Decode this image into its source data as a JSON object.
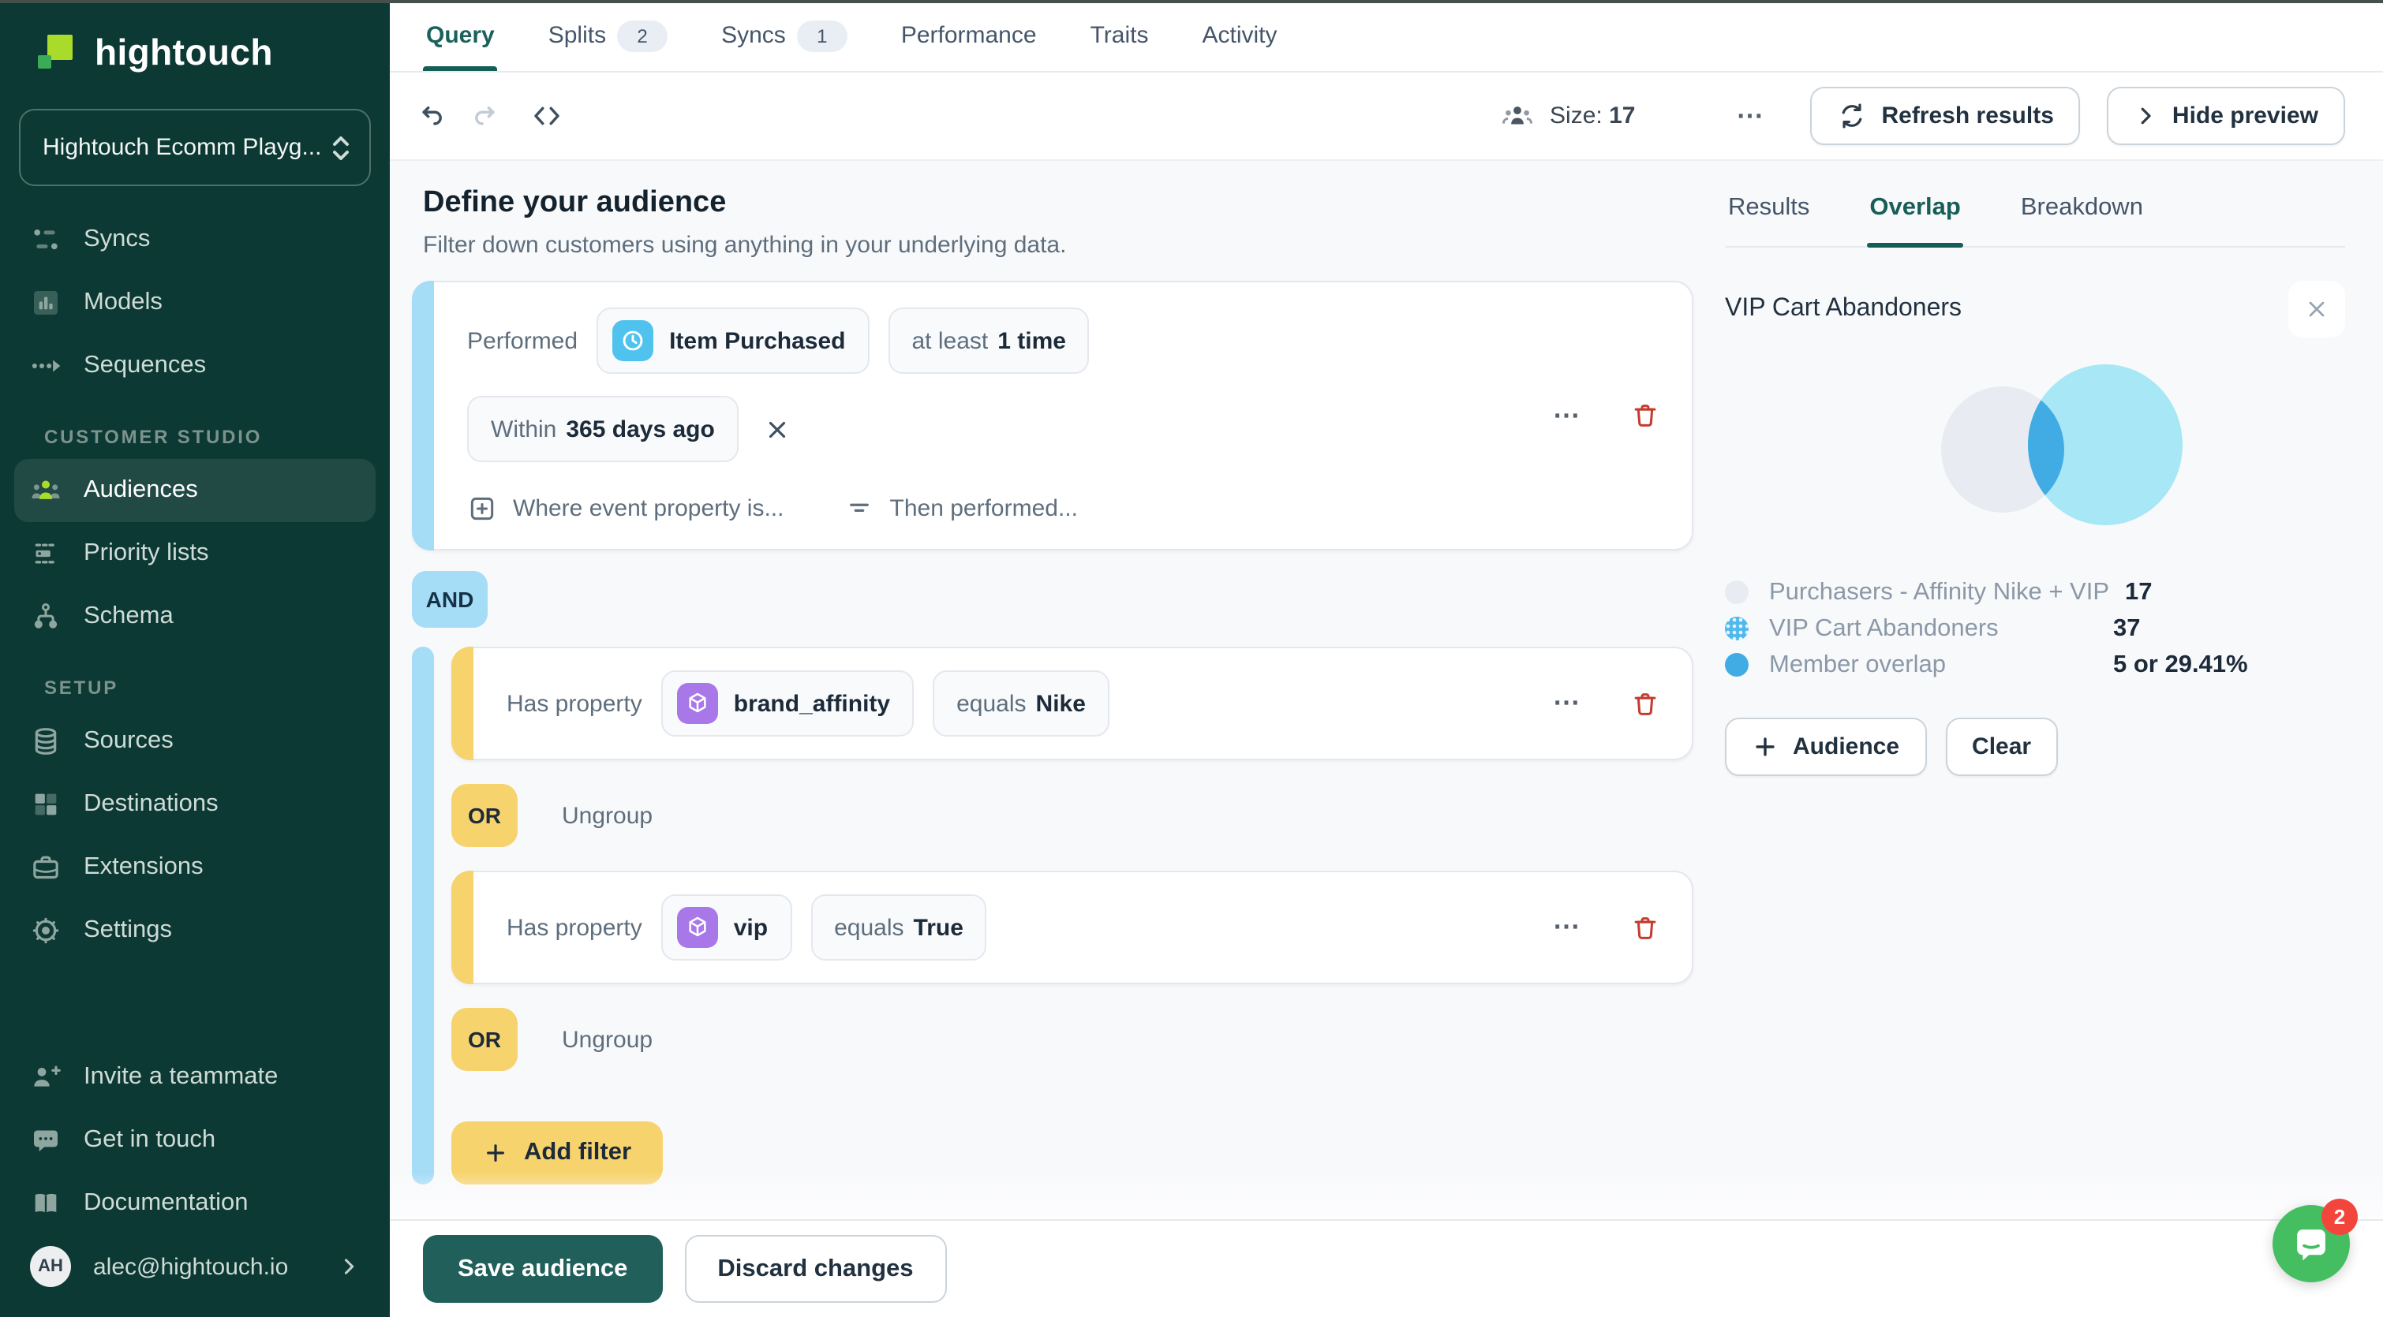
{
  "ui": {
    "more": "⋯"
  },
  "sidebar": {
    "logo": "hightouch",
    "workspace": "Hightouch Ecomm Playg...",
    "nav": [
      {
        "label": "Syncs"
      },
      {
        "label": "Models"
      },
      {
        "label": "Sequences"
      }
    ],
    "customer_studio": {
      "label": "CUSTOMER STUDIO",
      "items": [
        {
          "label": "Audiences",
          "active": true
        },
        {
          "label": "Priority lists"
        },
        {
          "label": "Schema"
        }
      ]
    },
    "setup": {
      "label": "SETUP",
      "items": [
        {
          "label": "Sources"
        },
        {
          "label": "Destinations"
        },
        {
          "label": "Extensions"
        },
        {
          "label": "Settings"
        }
      ]
    },
    "footer": [
      {
        "label": "Invite a teammate"
      },
      {
        "label": "Get in touch"
      },
      {
        "label": "Documentation"
      }
    ],
    "account": {
      "initials": "AH",
      "email": "alec@hightouch.io"
    }
  },
  "header": {
    "tabs": [
      {
        "label": "Query",
        "active": true
      },
      {
        "label": "Splits",
        "badge": "2"
      },
      {
        "label": "Syncs",
        "badge": "1"
      },
      {
        "label": "Performance"
      },
      {
        "label": "Traits"
      },
      {
        "label": "Activity"
      }
    ]
  },
  "toolbar": {
    "size_label": "Size:",
    "size_value": "17",
    "refresh": "Refresh results",
    "hide_preview": "Hide preview"
  },
  "builder": {
    "title": "Define your audience",
    "subtitle": "Filter down customers using anything in your underlying data.",
    "performed": {
      "prefix": "Performed",
      "event": "Item Purchased",
      "condition_label": "at least",
      "condition_value": "1 time",
      "window_label": "Within",
      "window_value": "365 days ago",
      "action_event_property": "Where event property is...",
      "action_then_performed": "Then performed..."
    },
    "and": "AND",
    "or": "OR",
    "ungroup": "Ungroup",
    "filters": [
      {
        "prefix": "Has property",
        "property": "brand_affinity",
        "operator": "equals",
        "value": "Nike"
      },
      {
        "prefix": "Has property",
        "property": "vip",
        "operator": "equals",
        "value": "True"
      }
    ],
    "add_filter": "Add filter",
    "save": "Save audience",
    "discard": "Discard changes"
  },
  "preview": {
    "tabs": [
      {
        "label": "Results"
      },
      {
        "label": "Overlap",
        "active": true
      },
      {
        "label": "Breakdown"
      }
    ],
    "selected_audience": "VIP Cart Abandoners",
    "legend": [
      {
        "label": "Purchasers - Affinity Nike + VIP",
        "value": "17"
      },
      {
        "label": "VIP Cart Abandoners",
        "value": "37"
      },
      {
        "label": "Member overlap",
        "value": "5 or 29.41%"
      }
    ],
    "add_audience": "Audience",
    "clear": "Clear"
  },
  "chart_data": {
    "type": "venn",
    "sets": [
      {
        "label": "Purchasers - Affinity Nike + VIP",
        "size": 17,
        "color": "#E9EBF3"
      },
      {
        "label": "VIP Cart Abandoners",
        "size": 37,
        "color": "#A7E7F6"
      }
    ],
    "intersection": {
      "label": "Member overlap",
      "size": 5,
      "percent": 29.41,
      "color": "#41ACE3"
    },
    "legend_position": "bottom"
  },
  "intercom": {
    "badge": "2"
  },
  "colors": {
    "sidebar_bg": "#0C3933",
    "accent_teal": "#1F615C",
    "accent_blue": "#A5DCF6",
    "accent_yellow": "#F7D36E",
    "event_icon_blue": "#4FC3EE",
    "property_icon_purple": "#A878E9",
    "danger_red": "#C43C2E",
    "venn_left": "#E9EBF3",
    "venn_right": "#A7E7F6",
    "venn_overlap": "#41ACE3",
    "intercom_green": "#45BE62",
    "badge_red": "#F2463C"
  }
}
